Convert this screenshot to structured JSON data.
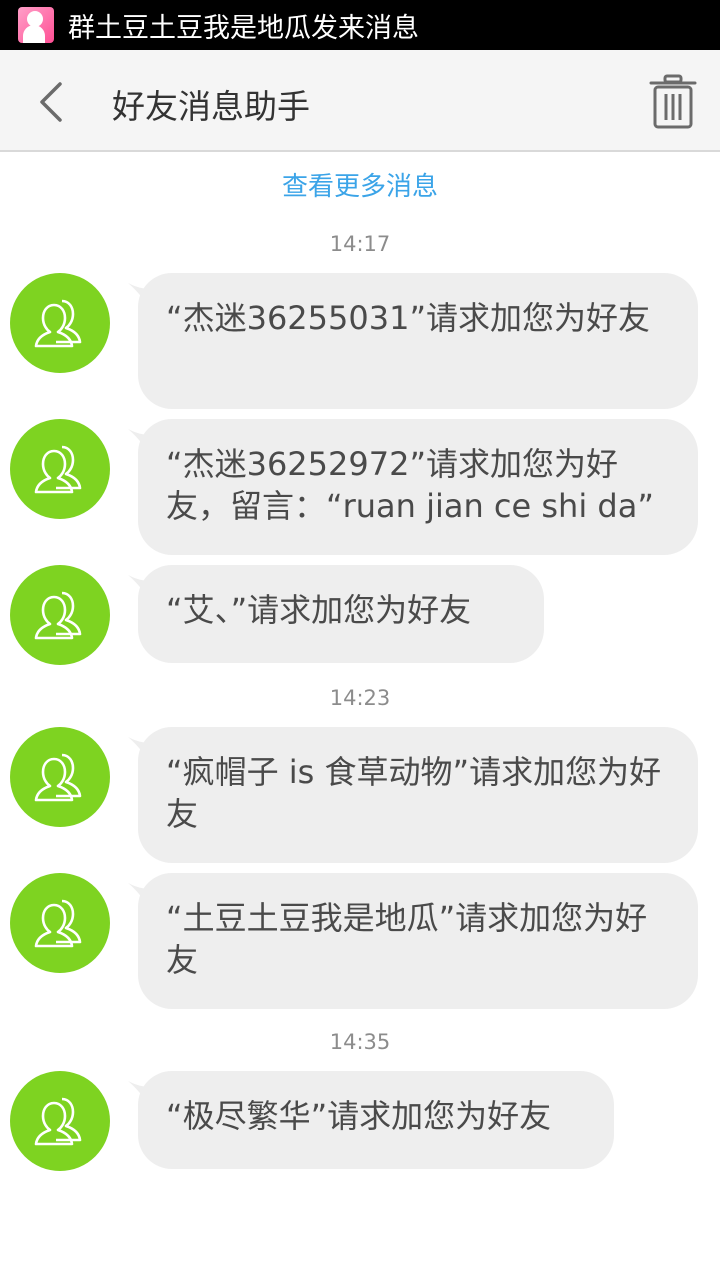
{
  "statusbar": {
    "app_icon": "app-avatar-icon",
    "notification_text": "群土豆土豆我是地瓜发来消息"
  },
  "header": {
    "back_icon": "chevron-left-icon",
    "title": "好友消息助手",
    "trash_icon": "trash-icon"
  },
  "content": {
    "more_link": "查看更多消息",
    "groups": [
      {
        "time": "14:17",
        "messages": [
          {
            "text": "“杰迷36255031”请求加您为好友"
          },
          {
            "text": "“杰迷36252972”请求加您为好友，留言：“ruan jian ce shi da”"
          },
          {
            "text": "“艾、”请求加您为好友"
          }
        ]
      },
      {
        "time": "14:23",
        "messages": [
          {
            "text": "“疯帽子 is 食草动物”请求加您为好友"
          },
          {
            "text": "“土豆土豆我是地瓜”请求加您为好友"
          }
        ]
      },
      {
        "time": "14:35",
        "messages": [
          {
            "text": "“极尽繁华”请求加您为好友"
          }
        ]
      }
    ]
  },
  "colors": {
    "accent_link": "#3ba4e8",
    "avatar_bg": "#7ed321",
    "bubble_bg": "#eeeeee",
    "header_bg": "#f5f5f5"
  }
}
